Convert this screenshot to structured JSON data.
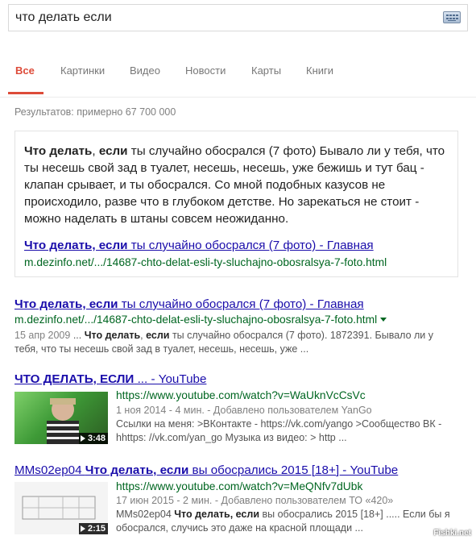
{
  "search": {
    "query": "что делать если"
  },
  "tabs": [
    "Все",
    "Картинки",
    "Видео",
    "Новости",
    "Карты",
    "Книги"
  ],
  "stats": "Результатов: примерно 67 700 000",
  "featured": {
    "text_b1": "Что делать",
    "text_t1": ", ",
    "text_b2": "если",
    "text_t2": " ты случайно обосрался (7 фото) Бывало ли у тебя, что ты несешь свой зад в туалет, несешь, несешь, уже бежишь и тут бац - клапан срывает, и ты обосрался. Со мной подобных казусов не происходило, разве что в глубоком детстве. Но зарекаться не стоит - можно наделать в штаны совсем неожиданно.",
    "link_b": "Что делать, если",
    "link_t": " ты случайно обосрался (7 фото) - Главная",
    "url": "m.dezinfo.net/.../14687-chto-delat-esli-ty-sluchajno-obosralsya-7-foto.html"
  },
  "results": [
    {
      "title_b": "Что делать, если",
      "title_t": " ты случайно обосрался (7 фото) - Главная",
      "url": "m.dezinfo.net/.../14687-chto-delat-esli-ty-sluchajno-obosralsya-7-foto.html",
      "date": "15 апр 2009",
      "snip1": " ... ",
      "snip_b1": "Что делать",
      "snip2": ", ",
      "snip_b2": "если",
      "snip3": " ты случайно обосрался (7 фото). 1872391. Бывало ли у тебя, что ты несешь свой зад в туалет, несешь, несешь, уже ..."
    },
    {
      "title_b": "ЧТО ДЕЛАТЬ, ЕСЛИ",
      "title_t": " ... - YouTube",
      "url": "https://www.youtube.com/watch?v=WaUknVcCsVc",
      "meta": "1 ноя 2014 - 4 мин. - Добавлено пользователем YanGo",
      "snip": "Ссылки на меня: >ВКонтакте - https://vk.com/yango >Сообщество ВК - hhttps: //vk.com/yan_go Музыка из видео: > http ...",
      "duration": "3:48"
    },
    {
      "title_t0": "MMs02ep04 ",
      "title_b": "Что делать, если",
      "title_t": " вы обосрались 2015 [18+] - YouTube",
      "url": "https://www.youtube.com/watch?v=MeQNfv7dUbk",
      "meta": "17 июн 2015 - 2 мин. - Добавлено пользователем ТО «420»",
      "snip_t1": "MMs02ep04 ",
      "snip_b": "Что делать, если",
      "snip_t2": " вы обосрались 2015 [18+] ..... Если бы я обосрался, случись это даже на красной площади ...",
      "duration": "2:15"
    }
  ],
  "watermark": "Fishki.net"
}
